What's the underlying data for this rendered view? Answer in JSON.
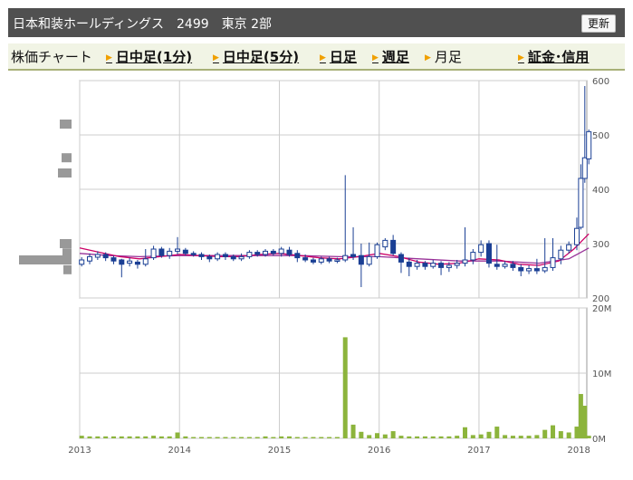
{
  "header": {
    "title": "日本和装ホールディングス　2499　東京 2部",
    "refresh_label": "更新"
  },
  "tabs": [
    {
      "label": "株価チャート",
      "arrow": false,
      "link": false
    },
    {
      "label": "日中足(1分)",
      "arrow": true,
      "link": true
    },
    {
      "label": "日中足(5分)",
      "arrow": true,
      "link": true
    },
    {
      "label": "日足",
      "arrow": true,
      "link": true
    },
    {
      "label": "週足",
      "arrow": true,
      "link": true
    },
    {
      "label": "月足",
      "arrow": true,
      "link": false
    },
    {
      "label": "証金･信用",
      "arrow": true,
      "link": true
    }
  ],
  "colors": {
    "up": "#ffffff",
    "up_stroke": "#1a3f94",
    "down": "#1a3f94",
    "ma_short": "#cc0066",
    "ma_long": "#993399",
    "volume": "#8cb43c",
    "grid": "#cccccc",
    "profile": "#999999"
  },
  "chart_data": [
    {
      "type": "candlestick",
      "title": "",
      "x_ticks": [
        "2013",
        "2014",
        "2015",
        "2016",
        "2017",
        "2018"
      ],
      "y_ticks": [
        "600",
        "500",
        "400",
        "300",
        "200"
      ],
      "ylim": [
        200,
        600
      ],
      "xlim": [
        2013.0,
        2018.08
      ],
      "candles": [
        [
          2013.02,
          262,
          270,
          275,
          258
        ],
        [
          2013.1,
          268,
          276,
          282,
          262
        ],
        [
          2013.18,
          275,
          280,
          286,
          270
        ],
        [
          2013.26,
          280,
          274,
          284,
          268
        ],
        [
          2013.34,
          274,
          268,
          278,
          262
        ],
        [
          2013.42,
          270,
          262,
          272,
          238
        ],
        [
          2013.5,
          264,
          268,
          274,
          258
        ],
        [
          2013.58,
          266,
          262,
          270,
          254
        ],
        [
          2013.66,
          262,
          272,
          290,
          258
        ],
        [
          2013.74,
          274,
          290,
          296,
          270
        ],
        [
          2013.82,
          290,
          278,
          294,
          274
        ],
        [
          2013.9,
          278,
          286,
          292,
          272
        ],
        [
          2013.98,
          286,
          290,
          312,
          280
        ],
        [
          2014.06,
          288,
          282,
          292,
          278
        ],
        [
          2014.14,
          282,
          280,
          286,
          276
        ],
        [
          2014.22,
          280,
          276,
          284,
          270
        ],
        [
          2014.3,
          276,
          272,
          280,
          266
        ],
        [
          2014.38,
          272,
          280,
          284,
          268
        ],
        [
          2014.46,
          280,
          276,
          284,
          270
        ],
        [
          2014.54,
          276,
          272,
          280,
          268
        ],
        [
          2014.62,
          272,
          276,
          282,
          268
        ],
        [
          2014.7,
          276,
          284,
          288,
          272
        ],
        [
          2014.78,
          284,
          280,
          288,
          276
        ],
        [
          2014.86,
          280,
          286,
          290,
          276
        ],
        [
          2014.94,
          286,
          282,
          290,
          278
        ],
        [
          2015.02,
          282,
          290,
          294,
          276
        ],
        [
          2015.1,
          288,
          280,
          294,
          276
        ],
        [
          2015.18,
          282,
          274,
          288,
          266
        ],
        [
          2015.26,
          274,
          270,
          280,
          266
        ],
        [
          2015.34,
          270,
          266,
          274,
          262
        ],
        [
          2015.42,
          266,
          272,
          276,
          262
        ],
        [
          2015.5,
          272,
          268,
          276,
          264
        ],
        [
          2015.58,
          268,
          270,
          274,
          264
        ],
        [
          2015.66,
          270,
          278,
          426,
          266
        ],
        [
          2015.74,
          280,
          276,
          330,
          270
        ],
        [
          2015.82,
          278,
          262,
          300,
          220
        ],
        [
          2015.9,
          262,
          276,
          302,
          258
        ],
        [
          2015.98,
          276,
          298,
          302,
          272
        ],
        [
          2016.06,
          294,
          306,
          310,
          288
        ],
        [
          2016.14,
          306,
          282,
          316,
          278
        ],
        [
          2016.22,
          280,
          266,
          284,
          246
        ],
        [
          2016.3,
          266,
          258,
          274,
          240
        ],
        [
          2016.38,
          258,
          264,
          270,
          252
        ],
        [
          2016.46,
          264,
          258,
          268,
          252
        ],
        [
          2016.54,
          258,
          264,
          270,
          254
        ],
        [
          2016.62,
          264,
          256,
          268,
          242
        ],
        [
          2016.7,
          256,
          260,
          266,
          248
        ],
        [
          2016.78,
          260,
          264,
          270,
          254
        ],
        [
          2016.86,
          264,
          270,
          330,
          258
        ],
        [
          2016.94,
          270,
          284,
          290,
          262
        ],
        [
          2017.02,
          284,
          298,
          306,
          276
        ],
        [
          2017.1,
          300,
          264,
          306,
          256
        ],
        [
          2017.18,
          262,
          258,
          298,
          252
        ],
        [
          2017.26,
          258,
          262,
          268,
          254
        ],
        [
          2017.34,
          262,
          256,
          268,
          250
        ],
        [
          2017.42,
          256,
          250,
          262,
          240
        ],
        [
          2017.5,
          250,
          254,
          260,
          244
        ],
        [
          2017.58,
          254,
          250,
          272,
          244
        ],
        [
          2017.66,
          250,
          256,
          310,
          246
        ],
        [
          2017.74,
          256,
          274,
          310,
          250
        ],
        [
          2017.82,
          272,
          288,
          296,
          262
        ],
        [
          2017.9,
          288,
          298,
          304,
          282
        ],
        [
          2017.98,
          298,
          328,
          348,
          288
        ],
        [
          2018.02,
          330,
          420,
          446,
          326
        ],
        [
          2018.06,
          420,
          458,
          590,
          412
        ],
        [
          2018.1,
          456,
          506,
          510,
          446
        ]
      ],
      "ma_short": [
        [
          2013.0,
          292
        ],
        [
          2013.2,
          284
        ],
        [
          2013.4,
          276
        ],
        [
          2013.6,
          272
        ],
        [
          2013.8,
          276
        ],
        [
          2014.0,
          280
        ],
        [
          2014.2,
          278
        ],
        [
          2014.4,
          276
        ],
        [
          2014.6,
          276
        ],
        [
          2014.8,
          280
        ],
        [
          2015.0,
          282
        ],
        [
          2015.2,
          278
        ],
        [
          2015.4,
          274
        ],
        [
          2015.6,
          272
        ],
        [
          2015.8,
          276
        ],
        [
          2016.0,
          282
        ],
        [
          2016.2,
          276
        ],
        [
          2016.4,
          266
        ],
        [
          2016.6,
          262
        ],
        [
          2016.8,
          264
        ],
        [
          2017.0,
          272
        ],
        [
          2017.2,
          270
        ],
        [
          2017.4,
          262
        ],
        [
          2017.6,
          260
        ],
        [
          2017.8,
          268
        ],
        [
          2017.95,
          290
        ],
        [
          2018.1,
          318
        ]
      ],
      "ma_long": [
        [
          2013.0,
          282
        ],
        [
          2013.3,
          278
        ],
        [
          2013.6,
          276
        ],
        [
          2014.0,
          278
        ],
        [
          2014.4,
          278
        ],
        [
          2014.8,
          278
        ],
        [
          2015.2,
          278
        ],
        [
          2015.6,
          276
        ],
        [
          2016.0,
          276
        ],
        [
          2016.4,
          272
        ],
        [
          2016.8,
          268
        ],
        [
          2017.2,
          268
        ],
        [
          2017.6,
          264
        ],
        [
          2017.9,
          272
        ],
        [
          2018.1,
          292
        ]
      ]
    },
    {
      "type": "bar",
      "title": "",
      "y_ticks": [
        "20M",
        "10M",
        "0M"
      ],
      "ylim": [
        0,
        20
      ],
      "unit": "M",
      "volume": [
        [
          2013.02,
          0.4
        ],
        [
          2013.1,
          0.3
        ],
        [
          2013.18,
          0.3
        ],
        [
          2013.26,
          0.3
        ],
        [
          2013.34,
          0.3
        ],
        [
          2013.42,
          0.3
        ],
        [
          2013.5,
          0.3
        ],
        [
          2013.58,
          0.3
        ],
        [
          2013.66,
          0.3
        ],
        [
          2013.74,
          0.4
        ],
        [
          2013.82,
          0.3
        ],
        [
          2013.9,
          0.3
        ],
        [
          2013.98,
          0.9
        ],
        [
          2014.06,
          0.3
        ],
        [
          2014.14,
          0.2
        ],
        [
          2014.22,
          0.2
        ],
        [
          2014.3,
          0.2
        ],
        [
          2014.38,
          0.2
        ],
        [
          2014.46,
          0.2
        ],
        [
          2014.54,
          0.2
        ],
        [
          2014.62,
          0.2
        ],
        [
          2014.7,
          0.2
        ],
        [
          2014.78,
          0.2
        ],
        [
          2014.86,
          0.3
        ],
        [
          2014.94,
          0.2
        ],
        [
          2015.02,
          0.3
        ],
        [
          2015.1,
          0.3
        ],
        [
          2015.18,
          0.2
        ],
        [
          2015.26,
          0.2
        ],
        [
          2015.34,
          0.2
        ],
        [
          2015.42,
          0.2
        ],
        [
          2015.5,
          0.2
        ],
        [
          2015.58,
          0.2
        ],
        [
          2015.66,
          15.5
        ],
        [
          2015.74,
          2.1
        ],
        [
          2015.82,
          1.0
        ],
        [
          2015.9,
          0.5
        ],
        [
          2015.98,
          0.8
        ],
        [
          2016.06,
          0.6
        ],
        [
          2016.14,
          1.1
        ],
        [
          2016.22,
          0.4
        ],
        [
          2016.3,
          0.3
        ],
        [
          2016.38,
          0.3
        ],
        [
          2016.46,
          0.3
        ],
        [
          2016.54,
          0.3
        ],
        [
          2016.62,
          0.3
        ],
        [
          2016.7,
          0.3
        ],
        [
          2016.78,
          0.4
        ],
        [
          2016.86,
          1.7
        ],
        [
          2016.94,
          0.5
        ],
        [
          2017.02,
          0.6
        ],
        [
          2017.1,
          1.0
        ],
        [
          2017.18,
          1.8
        ],
        [
          2017.26,
          0.5
        ],
        [
          2017.34,
          0.4
        ],
        [
          2017.42,
          0.4
        ],
        [
          2017.5,
          0.4
        ],
        [
          2017.58,
          0.5
        ],
        [
          2017.66,
          1.3
        ],
        [
          2017.74,
          2.0
        ],
        [
          2017.82,
          1.1
        ],
        [
          2017.9,
          0.9
        ],
        [
          2017.98,
          1.8
        ],
        [
          2018.02,
          6.8
        ],
        [
          2018.06,
          5.0
        ],
        [
          2018.1,
          0.4
        ]
      ]
    }
  ],
  "profile_bars": [
    {
      "price": 520,
      "size": 1.3
    },
    {
      "price": 300,
      "size": 1.3
    },
    {
      "price": 458,
      "size": 1.1
    },
    {
      "price": 430,
      "size": 1.5
    },
    {
      "price": 283,
      "size": 1.0
    },
    {
      "price": 270,
      "size": 5.8
    },
    {
      "price": 252,
      "size": 0.9
    }
  ]
}
